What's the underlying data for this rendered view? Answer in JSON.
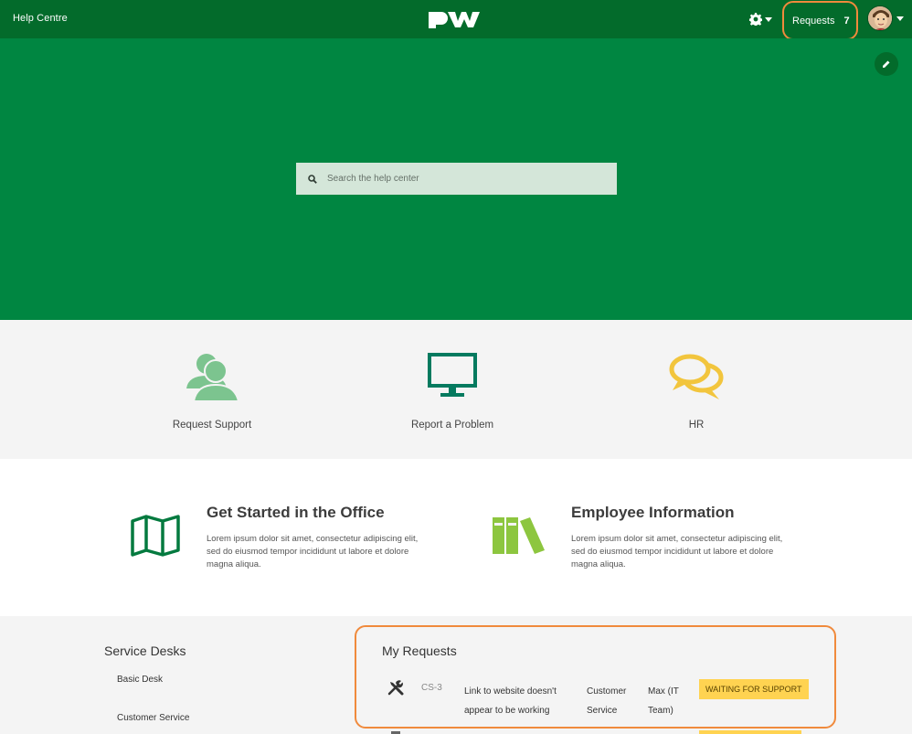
{
  "header": {
    "brand": "Help Centre",
    "logo_icon": "pw-logo-icon",
    "settings_icon": "gear-icon",
    "requests_label": "Requests",
    "requests_count": "7",
    "avatar_icon": "user-avatar"
  },
  "hero": {
    "edit_icon": "pencil-icon",
    "search": {
      "placeholder": "Search the help center",
      "value": ""
    }
  },
  "categories": [
    {
      "label": "Request Support",
      "icon": "people-icon"
    },
    {
      "label": "Report a Problem",
      "icon": "monitor-icon"
    },
    {
      "label": "HR",
      "icon": "chat-bubbles-icon"
    }
  ],
  "topics": [
    {
      "title": "Get Started in the Office",
      "description": "Lorem ipsum dolor sit amet, consectetur adipiscing elit, sed do eiusmod tempor incididunt ut labore et dolore magna aliqua.",
      "icon": "map-icon"
    },
    {
      "title": "Employee Information",
      "description": "Lorem ipsum dolor sit amet, consectetur adipiscing elit, sed do eiusmod tempor incididunt ut labore et dolore magna aliqua.",
      "icon": "books-icon"
    }
  ],
  "service_desks": {
    "title": "Service Desks",
    "items": [
      "Basic Desk",
      "Customer Service"
    ]
  },
  "my_requests": {
    "title": "My Requests",
    "rows": [
      {
        "icon": "tools-icon",
        "key": "CS-3",
        "summary": "Link to website doesn't appear to be working",
        "desk": "Customer Service",
        "assignee": "Max (IT Team)",
        "status": "WAITING FOR SUPPORT"
      }
    ]
  },
  "colors": {
    "header_green": "#036b2b",
    "hero_green": "#008641",
    "highlight_orange": "#f08a3c",
    "status_yellow": "#ffd351"
  }
}
